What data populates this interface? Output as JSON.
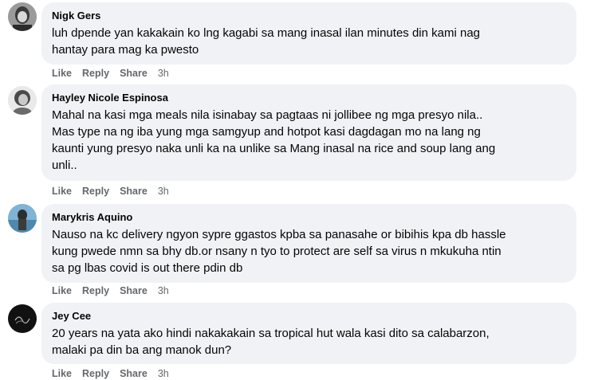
{
  "actions": {
    "like": "Like",
    "reply": "Reply",
    "share": "Share"
  },
  "comments": [
    {
      "author": "Nigk Gers",
      "lines": [
        "luh dpende yan kakakain ko lng kagabi sa mang inasal ilan minutes din kami nag",
        "hantay para mag ka pwesto"
      ],
      "time": "3h"
    },
    {
      "author": "Hayley Nicole Espinosa",
      "lines": [
        "Mahal na kasi mga meals nila isinabay sa pagtaas ni jollibee ng mga presyo nila..",
        "Mas type na ng iba yung mga samgyup and hotpot kasi dagdagan mo na lang ng",
        "kaunti yung presyo naka unli ka na unlike sa Mang inasal na rice and soup lang ang",
        "unli.."
      ],
      "time": "3h"
    },
    {
      "author": "Marykris Aquino",
      "lines": [
        "Nauso na kc delivery ngyon sypre ggastos kpba sa panasahe or bibihis kpa db hassle",
        "kung pwede nmn sa bhy db.or nsany n tyo to protect are self sa virus n mkukuha ntin",
        "sa pg lbas covid is out there pdin db"
      ],
      "time": "3h"
    },
    {
      "author": "Jey Cee",
      "lines": [
        "20 years na yata ako hindi nakakakain sa tropical hut wala kasi dito sa calabarzon,",
        "malaki pa din ba ang manok dun?"
      ],
      "time": "3h"
    }
  ]
}
